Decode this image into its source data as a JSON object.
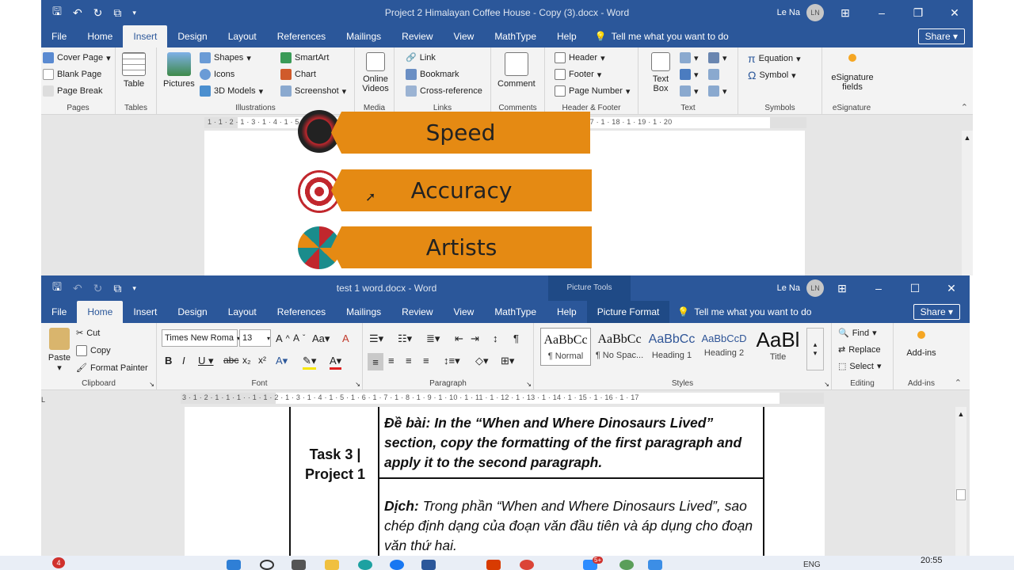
{
  "back_window": {
    "title": "Project 2 Himalayan Coffee House - Copy (3).docx  -  Word",
    "user": "Le Na",
    "avatar": "LN",
    "tabs": [
      "File",
      "Home",
      "Insert",
      "Design",
      "Layout",
      "References",
      "Mailings",
      "Review",
      "View",
      "MathType",
      "Help"
    ],
    "active_tab": "Insert",
    "tell_me": "Tell me what you want to do",
    "share": "Share",
    "ribbon": {
      "pages": {
        "label": "Pages",
        "items": [
          "Cover Page",
          "Blank Page",
          "Page Break"
        ]
      },
      "tables": {
        "label": "Tables",
        "table": "Table"
      },
      "illustrations": {
        "label": "Illustrations",
        "pictures": "Pictures",
        "shapes": "Shapes",
        "icons": "Icons",
        "models": "3D Models",
        "smartart": "SmartArt",
        "chart": "Chart",
        "screenshot": "Screenshot"
      },
      "media": {
        "label": "Media",
        "online_videos": "Online Videos"
      },
      "links": {
        "label": "Links",
        "link": "Link",
        "bookmark": "Bookmark",
        "cross_reference": "Cross-reference"
      },
      "comments": {
        "label": "Comments",
        "comment": "Comment"
      },
      "header_footer": {
        "label": "Header & Footer",
        "header": "Header",
        "footer": "Footer",
        "page_number": "Page Number"
      },
      "text": {
        "label": "Text",
        "text_box": "Text Box"
      },
      "symbols": {
        "label": "Symbols",
        "equation": "Equation",
        "symbol": "Symbol"
      },
      "esignature": {
        "label": "eSignature",
        "fields": "eSignature fields"
      }
    },
    "ruler": "1 · 1 · 2 · 1 · 3 · 1 · 4 · 1 · 5 · 1 · 6 · 1 · 7 · 1 · 8 · 1 · 9 · 1 · 10 · 1 · 11 · 1 · 12 · 1 · 13 · 1 · 14 · 1 · 15 · 1 · 16 · 1 · 17 · 1 · 18 · 1 · 19 · 1 · 20",
    "banners": [
      "Speed",
      "Accuracy",
      "Artists"
    ]
  },
  "front_window": {
    "title": "test 1 word.docx  -  Word",
    "picture_tools": "Picture Tools",
    "user": "Le Na",
    "avatar": "LN",
    "tabs": [
      "File",
      "Home",
      "Insert",
      "Design",
      "Layout",
      "References",
      "Mailings",
      "Review",
      "View",
      "MathType",
      "Help",
      "Picture Format"
    ],
    "active_tab": "Home",
    "tell_me": "Tell me what you want to do",
    "share": "Share",
    "ribbon": {
      "clipboard": {
        "label": "Clipboard",
        "paste": "Paste",
        "cut": "Cut",
        "copy": "Copy",
        "format_painter": "Format Painter"
      },
      "font": {
        "label": "Font",
        "font_name": "Times New Roma",
        "font_size": "13"
      },
      "paragraph": {
        "label": "Paragraph"
      },
      "styles": {
        "label": "Styles",
        "items": [
          {
            "preview": "AaBbCc",
            "name": "¶ Normal"
          },
          {
            "preview": "AaBbCc",
            "name": "¶ No Spac..."
          },
          {
            "preview": "AaBbCc",
            "name": "Heading 1"
          },
          {
            "preview": "AaBbCcD",
            "name": "Heading 2"
          },
          {
            "preview": "AaBl",
            "name": "Title"
          }
        ]
      },
      "editing": {
        "label": "Editing",
        "find": "Find",
        "replace": "Replace",
        "select": "Select"
      },
      "addins": {
        "label": "Add-ins",
        "addins": "Add-ins"
      }
    },
    "ruler": "3 · 1 · 2 · 1 · 1 · 1 · · 1 · 1 · 2 · 1 · 3 · 1 · 4 · 1 · 5 · 1 · 6 · 1 · 7 · 1 · 8 · 1 · 9 · 1 · 10 · 1 · 11 · 1 · 12 · 1 · 13 · 1 · 14 · 1 · 15 · 1 · 16 · 1 · 17",
    "doc": {
      "task_label": "Task 3 | Project 1",
      "de_bai_label": "Đề bài:",
      "de_bai_text": "In the “When and Where Dinosaurs Lived” section, copy the formatting of the first paragraph and apply it to the second paragraph.",
      "dich_label": "Dịch:",
      "dich_text": "Trong phần “When and Where Dinosaurs Lived”, sao chép định dạng của đoạn văn đầu tiên và áp dụng cho đoạn văn thứ hai."
    }
  },
  "taskbar": {
    "clock": "20:55",
    "lang": "ENG",
    "badge": "4",
    "badge2": "5+"
  }
}
